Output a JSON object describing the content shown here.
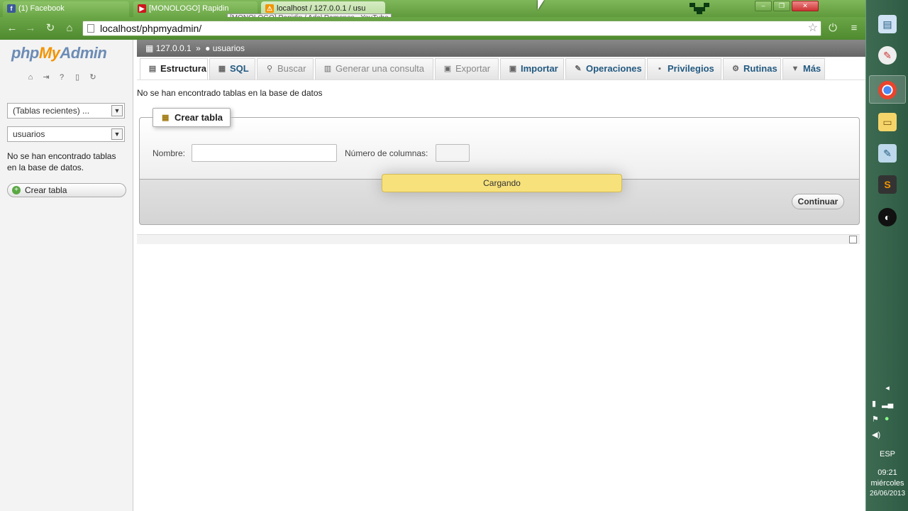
{
  "browser": {
    "tabs": [
      {
        "title": "(1) Facebook",
        "icon": "facebook-icon",
        "color": "#3b5998",
        "glyph": "f"
      },
      {
        "title": "[MONOLOGO] Rapidin",
        "icon": "youtube-icon",
        "color": "#cc181e",
        "glyph": "▶"
      },
      {
        "title": "localhost / 127.0.0.1 / usu",
        "icon": "phpmyadmin-icon",
        "color": "#f29400",
        "glyph": "⚠"
      }
    ],
    "tooltip": "[MONOLOGO] Rapidin / Adal Ramones - YouTube",
    "url": "localhost/phpmyadmin/",
    "window_controls": [
      "–",
      "❐",
      "✕"
    ]
  },
  "nav": {
    "logo_php": "php",
    "logo_my": "My",
    "logo_admin": "Admin",
    "recent_select": "(Tablas recientes) ...",
    "db_select": "usuarios",
    "empty_message": "No se han encontrado tablas en la base de datos.",
    "create_table": "Crear tabla"
  },
  "breadcrumb": {
    "server": "127.0.0.1",
    "separator": "»",
    "database": "usuarios"
  },
  "tabs": [
    {
      "label": "Estructura",
      "icon": "structure-icon",
      "glyph": "▤",
      "state": "active"
    },
    {
      "label": "SQL",
      "icon": "sql-icon",
      "glyph": "▦",
      "state": "normal"
    },
    {
      "label": "Buscar",
      "icon": "search-icon",
      "glyph": "⚲",
      "state": "disabled"
    },
    {
      "label": "Generar una consulta",
      "icon": "query-icon",
      "glyph": "▥",
      "state": "disabled"
    },
    {
      "label": "Exportar",
      "icon": "export-icon",
      "glyph": "▣",
      "state": "disabled"
    },
    {
      "label": "Importar",
      "icon": "import-icon",
      "glyph": "▣",
      "state": "normal"
    },
    {
      "label": "Operaciones",
      "icon": "wrench-icon",
      "glyph": "✎",
      "state": "normal"
    },
    {
      "label": "Privilegios",
      "icon": "privileges-icon",
      "glyph": "▪",
      "state": "normal"
    },
    {
      "label": "Rutinas",
      "icon": "routines-icon",
      "glyph": "⚙",
      "state": "normal"
    },
    {
      "label": "Más",
      "icon": "more-icon",
      "glyph": "▼",
      "state": "normal"
    }
  ],
  "main": {
    "message": "No se han encontrado tablas en la base de datos",
    "create": {
      "legend": "Crear tabla",
      "name_label": "Nombre:",
      "name_value": "",
      "columns_label": "Número de columnas:",
      "columns_value": "",
      "continue_button": "Continuar"
    },
    "loading": "Cargando"
  },
  "taskbar": {
    "apps": [
      "remote-desktop-icon",
      "paint-icon",
      "chrome-icon",
      "explorer-icon",
      "notepad-icon",
      "sublime-icon",
      "obs-icon"
    ],
    "language": "ESP",
    "time": "09:21",
    "day": "miércoles",
    "date": "26/06/2013"
  }
}
